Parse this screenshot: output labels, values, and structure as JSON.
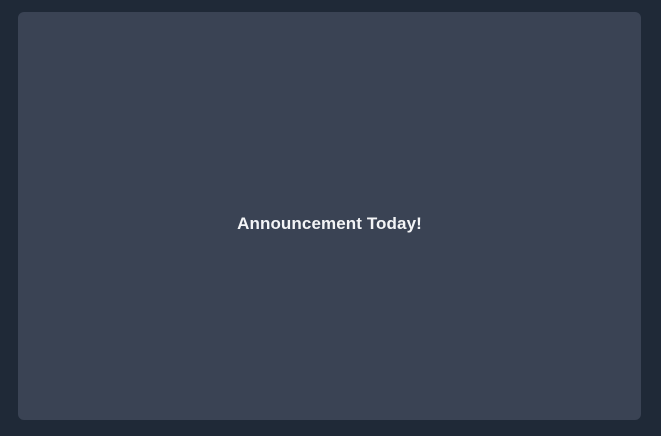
{
  "theme": {
    "page_background": "#1f2937",
    "card_background": "#3a4354",
    "text_color": "#f3f4f6"
  },
  "card": {
    "message": "Announcement Today!"
  }
}
